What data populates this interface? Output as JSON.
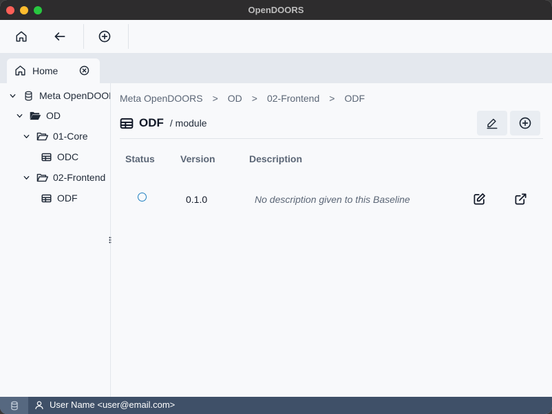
{
  "window": {
    "title": "OpenDOORS"
  },
  "tabs": [
    {
      "label": "Home"
    }
  ],
  "tree": {
    "root": "Meta OpenDOORS",
    "od": "OD",
    "core": "01-Core",
    "odc": "ODC",
    "frontend": "02-Frontend",
    "odf": "ODF"
  },
  "breadcrumb": [
    "Meta OpenDOORS",
    "OD",
    "02-Frontend",
    "ODF"
  ],
  "breadcrumb_sep": ">",
  "header": {
    "name": "ODF",
    "kind": "/ module"
  },
  "table": {
    "columns": {
      "status": "Status",
      "version": "Version",
      "description": "Description"
    },
    "rows": [
      {
        "version": "0.1.0",
        "description": "No description given to this Baseline"
      }
    ]
  },
  "statusbar": {
    "user": "User Name <user@email.com>"
  }
}
